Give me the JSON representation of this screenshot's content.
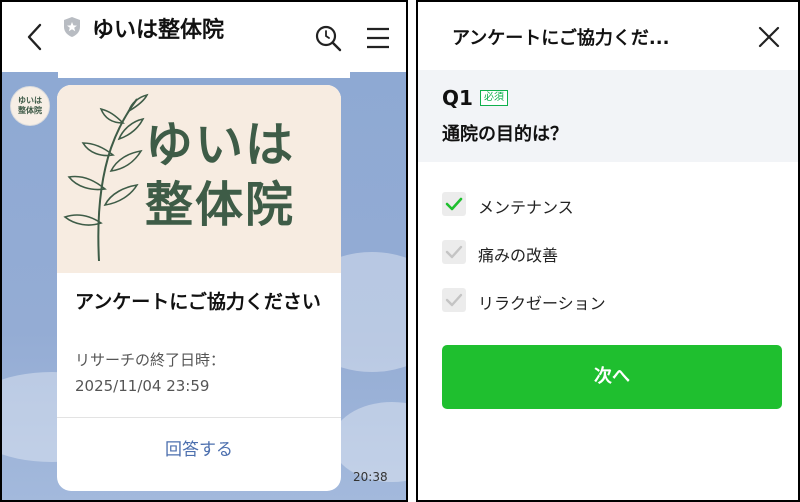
{
  "chat": {
    "title": "ゆいは整体院",
    "avatar_text": "ゆいは\n整体院",
    "card": {
      "hero_text": "ゆいは\n整体院",
      "title": "アンケートにご協力ください",
      "subtitle_line1": "リサーチの終了日時：",
      "subtitle_line2": "2025/11/04 23:59",
      "action_label": "回答する"
    },
    "time": "20:38"
  },
  "survey": {
    "header_title": "アンケートにご協力くだ...",
    "question_number": "Q1",
    "required_label": "必須",
    "question_text": "通院の目的は？",
    "options": [
      {
        "label": "メンテナンス",
        "checked": true
      },
      {
        "label": "痛みの改善",
        "checked": false
      },
      {
        "label": "リラクゼーション",
        "checked": false
      }
    ],
    "next_label": "次へ"
  },
  "colors": {
    "chat_bg": "#94acd4",
    "brand_green": "#3e5c47",
    "hero_bg": "#f7ece1",
    "link_blue": "#4c6fae",
    "primary_green": "#1fbf2f"
  },
  "icons": [
    "back-arrow-icon",
    "shield-icon",
    "search-icon",
    "menu-icon",
    "close-icon",
    "check-icon",
    "leaf-branch-icon"
  ]
}
